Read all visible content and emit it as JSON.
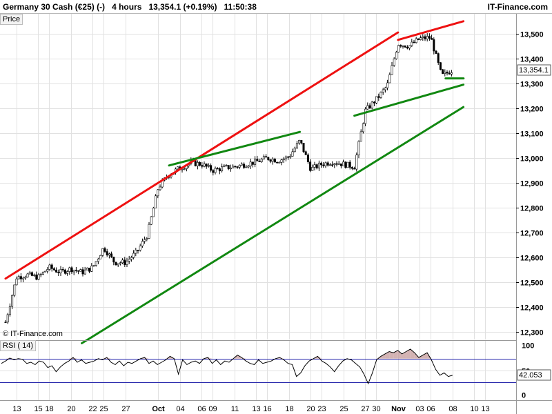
{
  "header": {
    "instrument": "Germany 30 Cash (€25) (-)",
    "timeframe": "4 hours",
    "last": "13,354.1 (+0.19%)",
    "time": "11:50:38",
    "site": "IT-Finance.com"
  },
  "chart_data": [
    {
      "type": "candlestick",
      "panel_label": "Price",
      "watermark": "© IT-Finance.com",
      "last_price_label": "13,354.1",
      "ylim": [
        12270,
        13580
      ],
      "yticks": [
        12300,
        12400,
        12500,
        12600,
        12700,
        12800,
        12900,
        13000,
        13100,
        13200,
        13300,
        13400,
        13500
      ],
      "ytick_labels": [
        "12,300",
        "12,400",
        "12,500",
        "12,600",
        "12,700",
        "12,800",
        "12,900",
        "13,000",
        "13,100",
        "13,200",
        "13,300",
        "13,400",
        "13,500"
      ],
      "grid": true,
      "x_axis": {
        "dates": [
          "Sep 12",
          "Sep 13",
          "Sep 14",
          "Sep 15",
          "Sep 18",
          "Sep 19",
          "Sep 20",
          "Sep 21",
          "Sep 22",
          "Sep 25",
          "Sep 26",
          "Sep 27",
          "Sep 28",
          "Sep 29",
          "Oct 02",
          "Oct 03",
          "Oct 04",
          "Oct 05",
          "Oct 06",
          "Oct 09",
          "Oct 10",
          "Oct 11",
          "Oct 12",
          "Oct 13",
          "Oct 16",
          "Oct 17",
          "Oct 18",
          "Oct 19",
          "Oct 20",
          "Oct 23",
          "Oct 24",
          "Oct 25",
          "Oct 26",
          "Oct 27",
          "Oct 30",
          "Oct 31",
          "Nov 01",
          "Nov 02",
          "Nov 03",
          "Nov 06",
          "Nov 07",
          "Nov 08",
          "Nov 09",
          "Nov 10",
          "Nov 13"
        ],
        "tick_labels": [
          "13",
          "15",
          "18",
          "20",
          "22",
          "25",
          "27",
          "Oct",
          "04",
          "06",
          "09",
          "11",
          "13",
          "16",
          "18",
          "20",
          "23",
          "25",
          "27",
          "30",
          "Nov",
          "03",
          "06",
          "08",
          "10",
          "13"
        ],
        "tick_dates": [
          "Sep 13",
          "Sep 15",
          "Sep 18",
          "Sep 20",
          "Sep 22",
          "Sep 25",
          "Sep 27",
          "Oct 02",
          "Oct 04",
          "Oct 06",
          "Oct 09",
          "Oct 11",
          "Oct 13",
          "Oct 16",
          "Oct 18",
          "Oct 20",
          "Oct 23",
          "Oct 25",
          "Oct 27",
          "Oct 30",
          "Nov 01",
          "Nov 03",
          "Nov 06",
          "Nov 08",
          "Nov 10",
          "Nov 13"
        ],
        "bold_labels": [
          "Oct",
          "Nov"
        ]
      },
      "close_path": [
        [
          "Sep 12",
          12340
        ],
        [
          "Sep 13",
          12520
        ],
        [
          "Sep 14",
          12530
        ],
        [
          "Sep 15",
          12520
        ],
        [
          "Sep 18",
          12560
        ],
        [
          "Sep 19",
          12540
        ],
        [
          "Sep 20",
          12555
        ],
        [
          "Sep 21",
          12540
        ],
        [
          "Sep 22",
          12560
        ],
        [
          "Sep 25",
          12640
        ],
        [
          "Sep 26",
          12580
        ],
        [
          "Sep 27",
          12580
        ],
        [
          "Sep 28",
          12620
        ],
        [
          "Sep 29",
          12690
        ],
        [
          "Oct 02",
          12880
        ],
        [
          "Oct 03",
          12935
        ],
        [
          "Oct 04",
          12960
        ],
        [
          "Oct 05",
          12980
        ],
        [
          "Oct 06",
          12975
        ],
        [
          "Oct 09",
          12950
        ],
        [
          "Oct 10",
          12960
        ],
        [
          "Oct 11",
          12965
        ],
        [
          "Oct 12",
          12975
        ],
        [
          "Oct 13",
          12985
        ],
        [
          "Oct 16",
          13000
        ],
        [
          "Oct 17",
          12990
        ],
        [
          "Oct 18",
          13005
        ],
        [
          "Oct 19",
          13070
        ],
        [
          "Oct 20",
          12955
        ],
        [
          "Oct 23",
          12975
        ],
        [
          "Oct 24",
          12985
        ],
        [
          "Oct 25",
          12975
        ],
        [
          "Oct 26",
          12965
        ],
        [
          "Oct 27",
          13190
        ],
        [
          "Oct 30",
          13235
        ],
        [
          "Oct 31",
          13290
        ],
        [
          "Nov 01",
          13460
        ],
        [
          "Nov 02",
          13450
        ],
        [
          "Nov 03",
          13480
        ],
        [
          "Nov 06",
          13485
        ],
        [
          "Nov 07",
          13330
        ],
        [
          "Nov 08",
          13354
        ]
      ],
      "trendlines": [
        {
          "color": "#ee1111",
          "from": [
            "Sep 12",
            12515
          ],
          "to": [
            "Nov 01",
            13505
          ]
        },
        {
          "color": "#ee1111",
          "from": [
            "Nov 01",
            13475
          ],
          "to": [
            "Nov 09",
            13550
          ]
        },
        {
          "color": "#118811",
          "from": [
            "Oct 03",
            12970
          ],
          "to": [
            "Oct 19",
            13105
          ]
        },
        {
          "color": "#118811",
          "from": [
            "Oct 26",
            13170
          ],
          "to": [
            "Nov 09",
            13295
          ]
        },
        {
          "color": "#118811",
          "from": [
            "Sep 21",
            12255
          ],
          "to": [
            "Nov 09",
            13205
          ]
        },
        {
          "color": "#118811",
          "from": [
            "Nov 08",
            13320
          ],
          "to": [
            "Nov 08",
            13320
          ],
          "kind": "short"
        }
      ]
    },
    {
      "type": "line",
      "panel_label": "RSI ( 14)",
      "ylim": [
        0,
        100
      ],
      "yticks": [
        0,
        50,
        100
      ],
      "levels": [
        70,
        30
      ],
      "last_value_label": "42.053",
      "values": [
        62,
        66,
        71,
        68,
        70,
        69,
        62,
        64,
        60,
        66,
        64,
        55,
        58,
        48,
        56,
        62,
        66,
        72,
        64,
        68,
        62,
        64,
        66,
        70,
        68,
        72,
        64,
        60,
        66,
        58,
        64,
        62,
        66,
        70,
        72,
        62,
        66,
        60,
        64,
        68,
        74,
        70,
        44,
        68,
        60,
        64,
        66,
        62,
        70,
        72,
        62,
        68,
        60,
        66,
        64,
        70,
        76,
        72,
        66,
        62,
        60,
        68,
        62,
        64,
        66,
        70,
        72,
        68,
        62,
        60,
        40,
        46,
        58,
        66,
        70,
        74,
        66,
        62,
        56,
        48,
        58,
        66,
        70,
        68,
        62,
        56,
        44,
        28,
        46,
        68,
        74,
        78,
        82,
        80,
        84,
        78,
        82,
        86,
        80,
        72,
        76,
        80,
        68,
        52,
        42,
        46,
        40,
        42
      ]
    }
  ]
}
